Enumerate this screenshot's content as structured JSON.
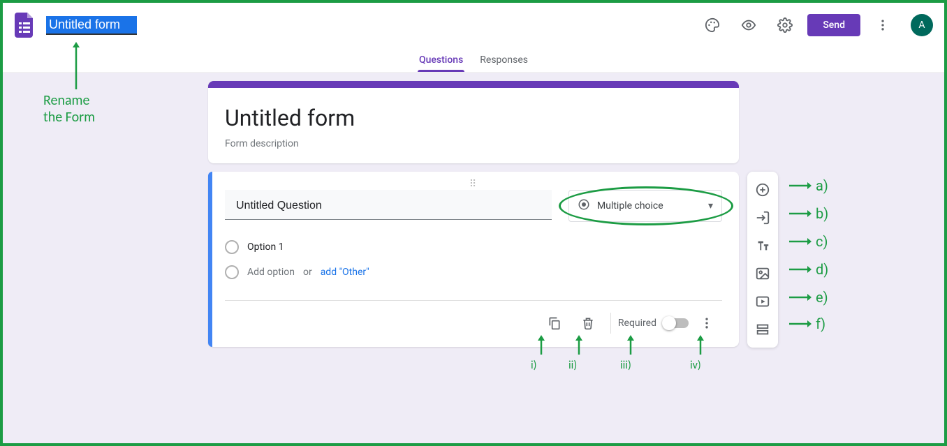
{
  "header": {
    "title_value": "Untitled form",
    "send_label": "Send",
    "avatar_letter": "A"
  },
  "tabs": {
    "questions": "Questions",
    "responses": "Responses"
  },
  "form": {
    "title": "Untitled form",
    "description": "Form description"
  },
  "question": {
    "title": "Untitled Question",
    "type_label": "Multiple choice",
    "option1": "Option 1",
    "add_option": "Add option",
    "or": "or",
    "add_other": "add \"Other\"",
    "required_label": "Required"
  },
  "annotations": {
    "rename": "Rename\nthe Form",
    "side": {
      "a": "a)",
      "b": "b)",
      "c": "c)",
      "d": "d)",
      "e": "e)",
      "f": "f)"
    },
    "bottom": {
      "i": "i)",
      "ii": "ii)",
      "iii": "iii)",
      "iv": "iv)"
    }
  },
  "icons": {
    "theme": "palette-icon",
    "preview": "eye-icon",
    "settings": "gear-icon",
    "more": "more-vert-icon",
    "add_question": "plus-circle-icon",
    "import": "import-icon",
    "title_desc": "text-icon",
    "image": "image-icon",
    "video": "video-icon",
    "section": "section-icon",
    "copy": "copy-icon",
    "delete": "trash-icon",
    "radio": "radio-icon",
    "dropdown": "chevron-down-icon"
  }
}
